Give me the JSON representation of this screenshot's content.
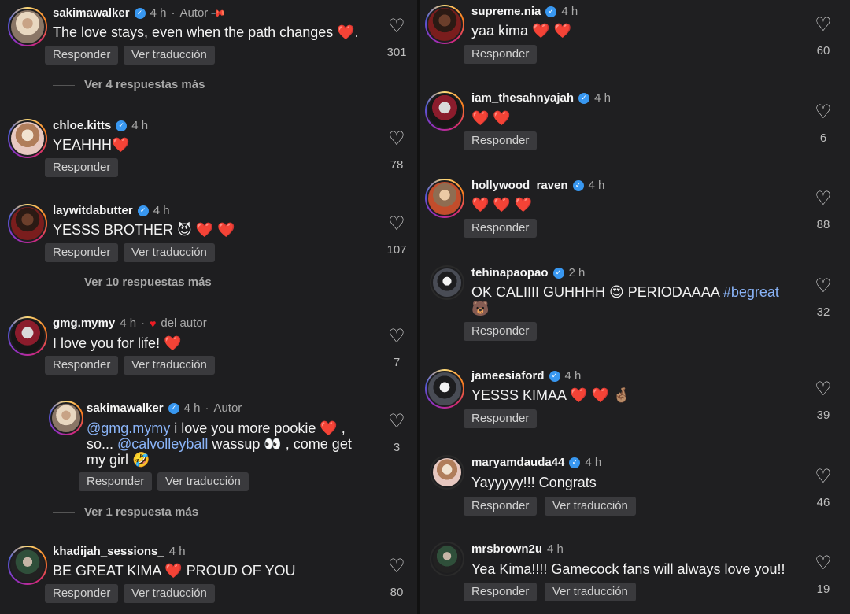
{
  "labels": {
    "reply": "Responder",
    "translate": "Ver traducción",
    "author": "Autor",
    "liked_by_author": "del autor"
  },
  "left": [
    {
      "user": "sakimawalker",
      "time": "4 h",
      "text": "The love stays, even when the path changes ❤️.",
      "likes": "301",
      "more": "Ver 4 respuestas más"
    },
    {
      "user": "chloe.kitts",
      "time": "4 h",
      "text": "YEAHHH❤️",
      "likes": "78"
    },
    {
      "user": "laywitdabutter",
      "time": "4 h",
      "text": "YESSS BROTHER 😈 ❤️ ❤️",
      "likes": "107",
      "more": "Ver 10 respuestas más"
    },
    {
      "user": "gmg.mymy",
      "time": "4 h",
      "text": "I love you for life! ❤️",
      "likes": "7"
    },
    {
      "user": "sakimawalker",
      "time": "4 h",
      "mention1": "@gmg.mymy",
      "text_a": " i love you more pookie ❤️ ,",
      "text_b1": "so... ",
      "mention2": "@calvolleyball",
      "text_b2": " wassup 👀 , come get",
      "text_c": "my girl 🤣",
      "likes": "3",
      "more": "Ver 1 respuesta más"
    },
    {
      "user": "khadijah_sessions_",
      "time": "4 h",
      "text": "BE GREAT KIMA ❤️ PROUD OF YOU",
      "likes": "80"
    }
  ],
  "right": [
    {
      "user": "supreme.nia",
      "time": "4 h",
      "text": "yaa kima ❤️ ❤️",
      "likes": "60"
    },
    {
      "user": "iam_thesahnyajah",
      "time": "4 h",
      "text": "❤️ ❤️",
      "likes": "6"
    },
    {
      "user": "hollywood_raven",
      "time": "4 h",
      "text": "❤️ ❤️ ❤️",
      "likes": "88"
    },
    {
      "user": "tehinapaopao",
      "time": "2 h",
      "text_a": "OK CALIIII GUHHHH 😍 PERIODAAAA ",
      "hashtag": "#begreat",
      "text_b": "🐻",
      "likes": "32"
    },
    {
      "user": "jameesiaford",
      "time": "4 h",
      "text": "YESSS KIMAA ❤️ ❤️ 🤞🏽",
      "likes": "39"
    },
    {
      "user": "maryamdauda44",
      "time": "4 h",
      "text": "Yayyyyy!!! Congrats",
      "likes": "46"
    },
    {
      "user": "mrsbrown2u",
      "time": "4 h",
      "text": "Yea Kima!!!! Gamecock fans will always love you!!",
      "likes": "19"
    }
  ],
  "icons": {
    "heart": "heart-outline-icon",
    "verified": "verified-badge-icon",
    "pin": "pin-icon"
  }
}
